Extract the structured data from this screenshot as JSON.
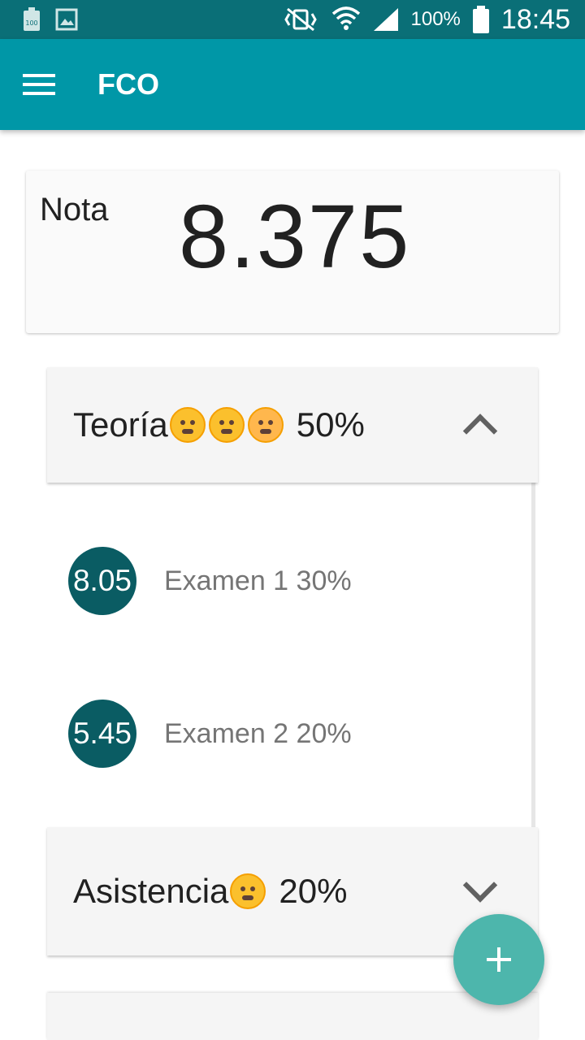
{
  "status_bar": {
    "battery_small_label": "100",
    "battery_percent": "100%",
    "time": "18:45"
  },
  "app_bar": {
    "title": "FCO",
    "menu_icon": "hamburger-menu-icon"
  },
  "grade_card": {
    "label": "Nota",
    "value": "8.375"
  },
  "sections": [
    {
      "title": "Teoría",
      "emojis": [
        "triumph-face-icon",
        "sleepy-face-icon",
        "angry-face-icon"
      ],
      "percent": "50%",
      "expanded": true,
      "items": [
        {
          "grade": "8.05",
          "label": "Examen 1 30%"
        },
        {
          "grade": "5.45",
          "label": "Examen 2 20%"
        }
      ]
    },
    {
      "title": "Asistencia",
      "emojis": [
        "sleeping-face-icon"
      ],
      "percent": "20%",
      "expanded": false,
      "items": []
    }
  ],
  "fab": {
    "icon": "plus-icon"
  },
  "colors": {
    "status_bar": "#0a6f77",
    "app_bar": "#0097a7",
    "grade_circle": "#0a5c63",
    "fab": "#4db6ac",
    "header_bg": "#f5f5f5"
  }
}
